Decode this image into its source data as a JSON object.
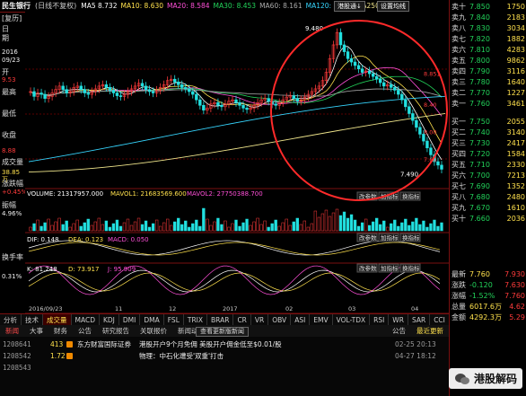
{
  "top": {
    "stock_name": "民生银行",
    "period": "(日线不复权)",
    "ma": [
      {
        "label": "MA5 8.732",
        "color": "#ffffff"
      },
      {
        "label": "MA10: 8.630",
        "color": "#ffe14d"
      },
      {
        "label": "MA20: 8.584",
        "color": "#ff4fd8"
      },
      {
        "label": "MA30: 8.453",
        "color": "#22d35a"
      },
      {
        "label": "MA60: 8.161",
        "color": "#aaaaaa"
      },
      {
        "label": "MA120: 7.893",
        "color": "#36d6ff"
      },
      {
        "label": "MA250: 7.478",
        "color": "#f0e68c"
      }
    ],
    "buttons": [
      "港股通↓",
      "设置均线"
    ]
  },
  "left": {
    "labels": [
      "日",
      "期"
    ],
    "date": "2016",
    "date2": "09/23",
    "history_label": "[复历]",
    "price_label": "开盘",
    "items": [
      {
        "name": "开",
        "val": "9.53"
      },
      {
        "name": "最高",
        "val": ""
      },
      {
        "name": "最低",
        "val": ""
      },
      {
        "name": "收盘",
        "val": "8.88"
      },
      {
        "name": "成交量",
        "val": "38.85万"
      },
      {
        "name": "涨跌幅",
        "val": "+0.45%"
      },
      {
        "name": "振幅",
        "val": "4.96%"
      },
      {
        "name": "换手率",
        "val": "0.31%"
      }
    ],
    "sub_labels": [
      "成交量",
      "DIF",
      "KDJ",
      "换手率"
    ],
    "sub_values": [
      "3.30",
      "",
      "0.00%",
      "0.31%"
    ]
  },
  "chart_data": {
    "type": "line",
    "title": "",
    "price_axis": [
      "8.851",
      "8.40",
      "8.00",
      "7.60"
    ],
    "x_labels": [
      "2016/09/23",
      "11",
      "12",
      "2017",
      "02",
      "03",
      "04"
    ],
    "high_mark": "9.480",
    "low_mark": "7.490",
    "volume": "VOLUME: 21317957.000",
    "mavol1": "MAVOL1: 21683569.600",
    "mavol2": "MAVOL2: 27750388.700",
    "macd_dif": "DIF: 0.148",
    "macd_dea": "DEA: 0.123",
    "macd": "MACD: 0.050",
    "kdj_k": "K: 81.248",
    "kdj_d": "D: 73.917",
    "kdj_j": "J: 95.909",
    "close": [
      8.62,
      8.55,
      8.6,
      8.58,
      8.52,
      8.55,
      8.6,
      8.65,
      8.7,
      8.65,
      8.6,
      8.62,
      8.68,
      8.7,
      8.65,
      8.6,
      8.58,
      8.62,
      8.66,
      8.7,
      8.72,
      8.68,
      8.64,
      8.6,
      8.56,
      8.55,
      8.58,
      8.62,
      8.66,
      8.7,
      8.74,
      8.7,
      8.65,
      8.62,
      8.6,
      8.64,
      8.68,
      8.72,
      8.78,
      8.8,
      8.76,
      8.72,
      8.68,
      8.66,
      8.62,
      8.58,
      8.5,
      8.42,
      8.35,
      8.38,
      8.44,
      8.46,
      8.42,
      8.4,
      8.44,
      8.48,
      8.5,
      8.46,
      8.42,
      8.38,
      8.36,
      8.38,
      8.42,
      8.46,
      8.5,
      8.52,
      8.48,
      8.44,
      8.42,
      8.46,
      8.5,
      8.54,
      8.56,
      8.52,
      8.48,
      8.5,
      8.54,
      8.58,
      8.62,
      8.66,
      8.7,
      8.78,
      8.9,
      9.1,
      9.3,
      9.48,
      9.3,
      9.2,
      9.1,
      9.05,
      9.0,
      8.95,
      8.9,
      8.92,
      8.88,
      8.84,
      8.8,
      8.75,
      8.7,
      8.72,
      8.68,
      8.64,
      8.58,
      8.5,
      8.4,
      8.3,
      8.2,
      8.1,
      8.0,
      7.9,
      7.8,
      7.7,
      7.6,
      7.55,
      7.49
    ]
  },
  "subpanel_btns": [
    "改参数",
    "加指标",
    "换指标"
  ],
  "tabs": [
    "分析",
    "技术",
    "成交量",
    "MACD",
    "KDJ",
    "DMI",
    "DMA",
    "FSL",
    "TRIX",
    "BRAR",
    "CR",
    "VR",
    "OBV",
    "ASI",
    "EMV",
    "VOL-TDX",
    "RSI",
    "WR",
    "SAR",
    "CCI",
    "MTM",
    "BOLL",
    "关联报价",
    "更多指标"
  ],
  "active_tab": 2,
  "news_tabs": [
    "新闻",
    "大事",
    "财务",
    "公告",
    "研究报告",
    "关联报价",
    "新闻动态"
  ],
  "news_active": 0,
  "news_center": "查看更新版新闻",
  "news_right": [
    "公告",
    "最近更新"
  ],
  "news": [
    {
      "code": "1208641",
      "num": "413",
      "source": "东方财富国际证券",
      "text": "港股开户9个月免佣 美股开户佣金低至$0.01/股",
      "time": "02-25 20:13"
    },
    {
      "code": "1208542",
      "num": "1.72",
      "source": "",
      "text": "物理：中石化遭受'双重'打击",
      "time": "04-27 18:12"
    },
    {
      "code": "1208543",
      "num": "",
      "source": "",
      "text": "",
      "time": ""
    }
  ],
  "order_book": {
    "header": "涨跌",
    "sell": [
      {
        "lbl": "卖十",
        "px": "7.850",
        "vol": "1750"
      },
      {
        "lbl": "卖九",
        "px": "7.840",
        "vol": "2183"
      },
      {
        "lbl": "卖八",
        "px": "7.830",
        "vol": "3034"
      },
      {
        "lbl": "卖七",
        "px": "7.820",
        "vol": "1882"
      },
      {
        "lbl": "卖六",
        "px": "7.810",
        "vol": "4283"
      },
      {
        "lbl": "卖五",
        "px": "7.800",
        "vol": "9862"
      },
      {
        "lbl": "卖四",
        "px": "7.790",
        "vol": "3116"
      },
      {
        "lbl": "卖三",
        "px": "7.780",
        "vol": "1640"
      },
      {
        "lbl": "卖二",
        "px": "7.770",
        "vol": "1227"
      },
      {
        "lbl": "卖一",
        "px": "7.760",
        "vol": "3461"
      }
    ],
    "buy": [
      {
        "lbl": "买一",
        "px": "7.750",
        "vol": "2055"
      },
      {
        "lbl": "买二",
        "px": "7.740",
        "vol": "3140"
      },
      {
        "lbl": "买三",
        "px": "7.730",
        "vol": "2417"
      },
      {
        "lbl": "买四",
        "px": "7.720",
        "vol": "1584"
      },
      {
        "lbl": "买五",
        "px": "7.710",
        "vol": "2330"
      },
      {
        "lbl": "买六",
        "px": "7.700",
        "vol": "7213"
      },
      {
        "lbl": "买七",
        "px": "7.690",
        "vol": "1352"
      },
      {
        "lbl": "买八",
        "px": "7.680",
        "vol": "2480"
      },
      {
        "lbl": "买九",
        "px": "7.670",
        "vol": "1610"
      },
      {
        "lbl": "买十",
        "px": "7.660",
        "vol": "2036"
      }
    ],
    "stats": [
      {
        "lbl": "最新",
        "val": "7.760",
        "val2": "7.930"
      },
      {
        "lbl": "涨跌",
        "val": "-0.120",
        "val2": "7.630"
      },
      {
        "lbl": "涨幅",
        "val": "-1.52%",
        "val2": "7.760"
      },
      {
        "lbl": "总量",
        "val": "6017.6万",
        "val2": "4.62"
      },
      {
        "lbl": "金额",
        "val": "4292.3万",
        "val2": "5.29"
      }
    ]
  },
  "watermark": "港股解码"
}
